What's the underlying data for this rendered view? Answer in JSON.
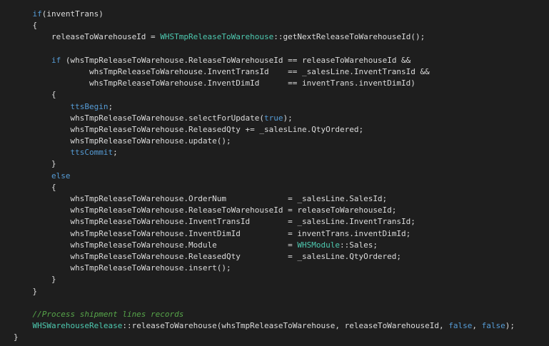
{
  "code": {
    "language": "X++",
    "colors": {
      "background": "#1e1e1e",
      "text": "#dcdcdc",
      "keyword": "#569cd6",
      "type": "#4ec9b0",
      "comment": "#57a64a"
    },
    "lines": [
      [
        {
          "t": "kw",
          "s": "    if"
        },
        {
          "t": "tx",
          "s": "(inventTrans)"
        }
      ],
      [
        {
          "t": "tx",
          "s": "    {"
        }
      ],
      [
        {
          "t": "tx",
          "s": "        releaseToWarehouseId = "
        },
        {
          "t": "ty",
          "s": "WHSTmpReleaseToWarehouse"
        },
        {
          "t": "tx",
          "s": "::getNextReleaseToWarehouseId();"
        }
      ],
      [
        {
          "t": "tx",
          "s": ""
        }
      ],
      [
        {
          "t": "kw",
          "s": "        if"
        },
        {
          "t": "tx",
          "s": " (whsTmpReleaseToWarehouse.ReleaseToWarehouseId == releaseToWarehouseId &&"
        }
      ],
      [
        {
          "t": "tx",
          "s": "                whsTmpReleaseToWarehouse.InventTransId    == _salesLine.InventTransId &&"
        }
      ],
      [
        {
          "t": "tx",
          "s": "                whsTmpReleaseToWarehouse.InventDimId      == inventTrans.inventDimId)"
        }
      ],
      [
        {
          "t": "tx",
          "s": "        {"
        }
      ],
      [
        {
          "t": "kw",
          "s": "            ttsBegin"
        },
        {
          "t": "tx",
          "s": ";"
        }
      ],
      [
        {
          "t": "tx",
          "s": "            whsTmpReleaseToWarehouse.selectForUpdate("
        },
        {
          "t": "kw",
          "s": "true"
        },
        {
          "t": "tx",
          "s": ");"
        }
      ],
      [
        {
          "t": "tx",
          "s": "            whsTmpReleaseToWarehouse.ReleasedQty += _salesLine.QtyOrdered;"
        }
      ],
      [
        {
          "t": "tx",
          "s": "            whsTmpReleaseToWarehouse.update();"
        }
      ],
      [
        {
          "t": "kw",
          "s": "            ttsCommit"
        },
        {
          "t": "tx",
          "s": ";"
        }
      ],
      [
        {
          "t": "tx",
          "s": "        }"
        }
      ],
      [
        {
          "t": "kw",
          "s": "        else"
        }
      ],
      [
        {
          "t": "tx",
          "s": "        {"
        }
      ],
      [
        {
          "t": "tx",
          "s": "            whsTmpReleaseToWarehouse.OrderNum             = _salesLine.SalesId;"
        }
      ],
      [
        {
          "t": "tx",
          "s": "            whsTmpReleaseToWarehouse.ReleaseToWarehouseId = releaseToWarehouseId;"
        }
      ],
      [
        {
          "t": "tx",
          "s": "            whsTmpReleaseToWarehouse.InventTransId        = _salesLine.InventTransId;"
        }
      ],
      [
        {
          "t": "tx",
          "s": "            whsTmpReleaseToWarehouse.InventDimId          = inventTrans.inventDimId;"
        }
      ],
      [
        {
          "t": "tx",
          "s": "            whsTmpReleaseToWarehouse.Module               = "
        },
        {
          "t": "ty",
          "s": "WHSModule"
        },
        {
          "t": "tx",
          "s": "::Sales;"
        }
      ],
      [
        {
          "t": "tx",
          "s": "            whsTmpReleaseToWarehouse.ReleasedQty          = _salesLine.QtyOrdered;"
        }
      ],
      [
        {
          "t": "tx",
          "s": "            whsTmpReleaseToWarehouse.insert();"
        }
      ],
      [
        {
          "t": "tx",
          "s": "        }"
        }
      ],
      [
        {
          "t": "tx",
          "s": "    }"
        }
      ],
      [
        {
          "t": "tx",
          "s": ""
        }
      ],
      [
        {
          "t": "cm",
          "s": "    //Process shipment lines records"
        }
      ],
      [
        {
          "t": "ty",
          "s": "    WHSWarehouseRelease"
        },
        {
          "t": "tx",
          "s": "::releaseToWarehouse(whsTmpReleaseToWarehouse, releaseToWarehouseId, "
        },
        {
          "t": "kw",
          "s": "false"
        },
        {
          "t": "tx",
          "s": ", "
        },
        {
          "t": "kw",
          "s": "false"
        },
        {
          "t": "tx",
          "s": ");"
        }
      ],
      [
        {
          "t": "tx",
          "s": "}"
        }
      ]
    ]
  }
}
